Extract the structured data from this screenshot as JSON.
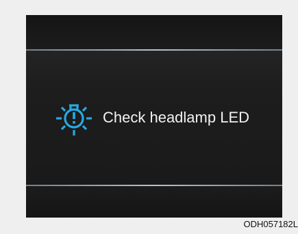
{
  "warning": {
    "icon": "headlamp-warning-icon",
    "message": "Check headlamp LED",
    "icon_color": "#29a9e1",
    "text_color": "#f2f2f2"
  },
  "figure": {
    "code": "ODH057182L"
  },
  "colors": {
    "screen_background": "#1b1b1b",
    "divider": "#b4c4d0",
    "page_background": "#efefef"
  }
}
